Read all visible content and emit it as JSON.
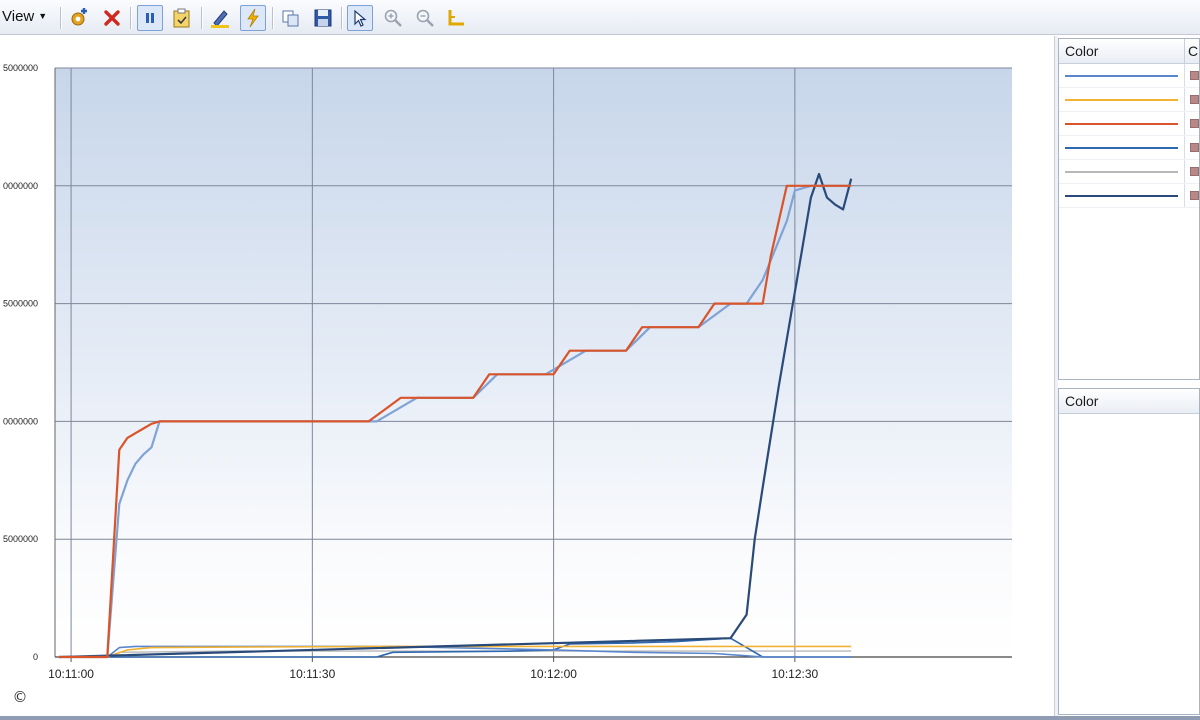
{
  "toolbar": {
    "view_label": "View",
    "buttons": [
      {
        "name": "add-counter-icon"
      },
      {
        "name": "delete-icon"
      },
      {
        "name": "freeze-display-icon"
      },
      {
        "name": "update-data-icon"
      },
      {
        "name": "highlight-icon"
      },
      {
        "name": "properties-icon"
      },
      {
        "name": "copy-properties-icon"
      },
      {
        "name": "save-icon"
      },
      {
        "name": "select-icon"
      },
      {
        "name": "zoom-in-icon"
      },
      {
        "name": "zoom-out-icon"
      },
      {
        "name": "axis-icon"
      }
    ]
  },
  "legend_panel": {
    "col1_header": "Color",
    "col2_header": "C",
    "rows": [
      {
        "color": "#5b86cc"
      },
      {
        "color": "#f2b233"
      },
      {
        "color": "#d9542b"
      },
      {
        "color": "#2e68b0"
      },
      {
        "color": "#b8b8b8"
      },
      {
        "color": "#2a4a7a"
      }
    ]
  },
  "lower_panel": {
    "header": "Color"
  },
  "copyright": "©",
  "chart_data": {
    "type": "line",
    "x_tick_labels": [
      "10:11:00",
      "10:11:30",
      "10:12:00",
      "10:12:30"
    ],
    "x_ticks_sec": [
      0,
      30,
      60,
      90
    ],
    "xlim": [
      -2,
      117
    ],
    "y_tick_labels": [
      "0",
      "5000000",
      "0000000",
      "5000000",
      "0000000",
      "5000000"
    ],
    "ylim": [
      0,
      25000000
    ],
    "grid": true,
    "series": [
      {
        "color": "#d9542b",
        "width": 2.2,
        "x": [
          -1.5,
          4.5,
          6,
          7,
          8,
          9,
          10,
          11,
          37,
          39,
          41,
          48,
          50,
          52,
          57,
          60,
          62,
          67,
          69,
          71,
          76,
          78,
          80,
          83,
          85,
          86,
          87,
          89,
          92,
          97
        ],
        "values": [
          0,
          0,
          8800000,
          9300000,
          9500000,
          9700000,
          9900000,
          10000000,
          10000000,
          10500000,
          11000000,
          11000000,
          11000000,
          12000000,
          12000000,
          12000000,
          13000000,
          13000000,
          13000000,
          14000000,
          14000000,
          14000000,
          15000000,
          15000000,
          15000000,
          15000000,
          17000000,
          20000000,
          20000000,
          20000000
        ]
      },
      {
        "color": "#7fa3d6",
        "width": 2.2,
        "x": [
          -1.5,
          4.5,
          6,
          7,
          8,
          9,
          10,
          11,
          38,
          43,
          50,
          53,
          59,
          64,
          69,
          72,
          78,
          82,
          84,
          86,
          89,
          90,
          92,
          97
        ],
        "values": [
          0,
          0,
          6500000,
          7500000,
          8200000,
          8600000,
          8900000,
          10000000,
          10000000,
          11000000,
          11000000,
          12000000,
          12000000,
          13000000,
          13000000,
          14000000,
          14000000,
          15000000,
          15000000,
          16000000,
          18500000,
          19800000,
          20000000,
          20000000
        ]
      },
      {
        "color": "#2a4a7a",
        "width": 2.2,
        "x": [
          -1.5,
          82,
          84,
          85,
          86,
          88,
          90,
          92,
          93,
          94,
          95,
          96,
          97
        ],
        "values": [
          0,
          800000,
          1800000,
          5000000,
          7200000,
          11500000,
          15500000,
          19500000,
          20500000,
          19500000,
          19200000,
          19000000,
          20300000
        ]
      },
      {
        "color": "#f2b233",
        "width": 1.6,
        "x": [
          -1.5,
          4.5,
          7,
          10,
          20,
          40,
          60,
          80,
          97
        ],
        "values": [
          0,
          0,
          300000,
          400000,
          420000,
          450000,
          450000,
          450000,
          450000
        ]
      },
      {
        "color": "#5b86cc",
        "width": 1.6,
        "x": [
          -1.5,
          4.5,
          6,
          8,
          20,
          37,
          40,
          60,
          70,
          80,
          84,
          86,
          97
        ],
        "values": [
          0,
          0,
          400000,
          450000,
          450000,
          450000,
          450000,
          300000,
          200000,
          150000,
          50000,
          0,
          0
        ]
      },
      {
        "color": "#2e68b0",
        "width": 1.6,
        "x": [
          -1.5,
          38,
          40,
          55,
          60,
          62,
          70,
          75,
          82,
          84,
          86,
          97
        ],
        "values": [
          0,
          0,
          200000,
          250000,
          300000,
          550000,
          600000,
          650000,
          800000,
          400000,
          0,
          0
        ]
      },
      {
        "color": "#b8b8b8",
        "width": 1.4,
        "x": [
          -1.5,
          4.5,
          6,
          20,
          40,
          60,
          80,
          97
        ],
        "values": [
          0,
          0,
          200000,
          250000,
          250000,
          250000,
          250000,
          250000
        ]
      }
    ]
  }
}
